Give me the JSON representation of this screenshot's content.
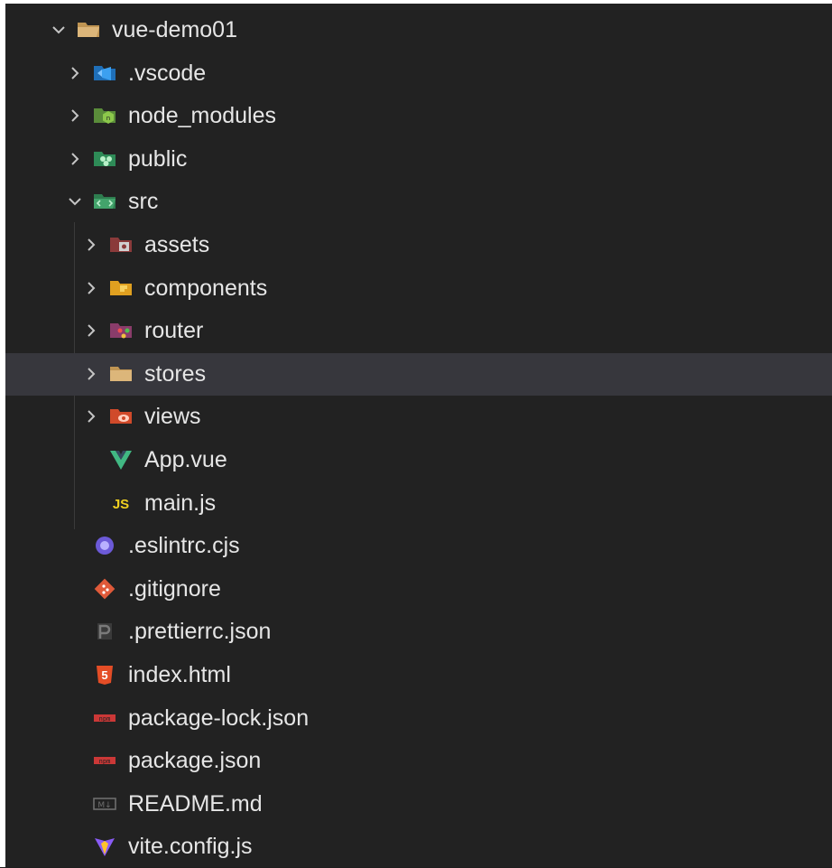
{
  "explorer": {
    "items": [
      {
        "label": "vue-demo01",
        "depth": 0,
        "kind": "folder",
        "expanded": true,
        "icon": "folder-open-icon"
      },
      {
        "label": ".vscode",
        "depth": 1,
        "kind": "folder",
        "expanded": false,
        "icon": "vscode-folder-icon"
      },
      {
        "label": "node_modules",
        "depth": 1,
        "kind": "folder",
        "expanded": false,
        "icon": "node-folder-icon"
      },
      {
        "label": "public",
        "depth": 1,
        "kind": "folder",
        "expanded": false,
        "icon": "public-folder-icon"
      },
      {
        "label": "src",
        "depth": 1,
        "kind": "folder",
        "expanded": true,
        "icon": "src-folder-icon"
      },
      {
        "label": "assets",
        "depth": 2,
        "kind": "folder",
        "expanded": false,
        "icon": "assets-folder-icon"
      },
      {
        "label": "components",
        "depth": 2,
        "kind": "folder",
        "expanded": false,
        "icon": "components-folder-icon"
      },
      {
        "label": "router",
        "depth": 2,
        "kind": "folder",
        "expanded": false,
        "icon": "router-folder-icon"
      },
      {
        "label": "stores",
        "depth": 2,
        "kind": "folder",
        "expanded": false,
        "icon": "folder-icon",
        "selected": true
      },
      {
        "label": "views",
        "depth": 2,
        "kind": "folder",
        "expanded": false,
        "icon": "views-folder-icon"
      },
      {
        "label": "App.vue",
        "depth": 2,
        "kind": "file",
        "icon": "vue-icon"
      },
      {
        "label": "main.js",
        "depth": 2,
        "kind": "file",
        "icon": "javascript-icon"
      },
      {
        "label": ".eslintrc.cjs",
        "depth": 1,
        "kind": "file",
        "icon": "eslint-icon"
      },
      {
        "label": ".gitignore",
        "depth": 1,
        "kind": "file",
        "icon": "git-icon"
      },
      {
        "label": ".prettierrc.json",
        "depth": 1,
        "kind": "file",
        "icon": "prettier-icon"
      },
      {
        "label": "index.html",
        "depth": 1,
        "kind": "file",
        "icon": "html5-icon"
      },
      {
        "label": "package-lock.json",
        "depth": 1,
        "kind": "file",
        "icon": "npm-icon"
      },
      {
        "label": "package.json",
        "depth": 1,
        "kind": "file",
        "icon": "npm-icon"
      },
      {
        "label": "README.md",
        "depth": 1,
        "kind": "file",
        "icon": "markdown-icon"
      },
      {
        "label": "vite.config.js",
        "depth": 1,
        "kind": "file",
        "icon": "vite-icon"
      }
    ]
  },
  "colors": {
    "background": "#222222",
    "selected_row": "#37373d",
    "text": "#e6e6e6",
    "chevron": "#c5c5c5"
  }
}
